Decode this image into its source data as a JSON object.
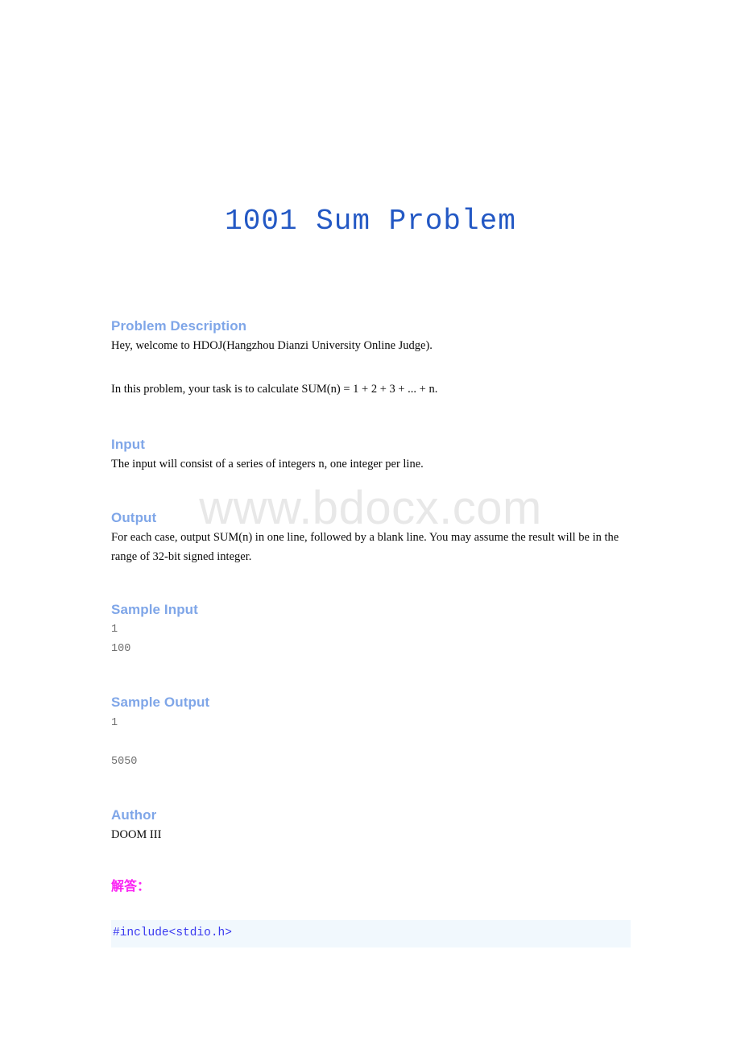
{
  "document": {
    "title": "1001 Sum Problem",
    "watermark": "www.bdocx.com"
  },
  "sections": {
    "description": {
      "heading": "Problem Description",
      "paragraph_1": "Hey, welcome to HDOJ(Hangzhou Dianzi University Online Judge).",
      "paragraph_2": "In this problem, your task is to calculate SUM(n) = 1 + 2 + 3 + ... + n."
    },
    "input": {
      "heading": "Input",
      "paragraph": "The input will consist of a series of integers n, one integer per line."
    },
    "output": {
      "heading": "Output",
      "paragraph": "For each case, output SUM(n) in one line, followed by a blank line. You may assume the result will be in the range of 32-bit signed integer."
    },
    "sample_input": {
      "heading": "Sample Input",
      "content": "1\n100"
    },
    "sample_output": {
      "heading": "Sample Output",
      "content": "1\n\n5050"
    },
    "author": {
      "heading": "Author",
      "name": "DOOM III"
    },
    "solution": {
      "label": "解答：",
      "code": "#include<stdio.h>"
    }
  },
  "colors": {
    "title_blue": "#2358c4",
    "heading_blue": "#7fa6e8",
    "body_black": "#0a0a0a",
    "mono_gray": "#6f6f6f",
    "answer_magenta": "#fb22f4",
    "code_text_blue": "#3a3af0",
    "code_background": "#f1f8fd",
    "watermark_gray": "#e8e8e8",
    "page_background": "#ffffff"
  }
}
